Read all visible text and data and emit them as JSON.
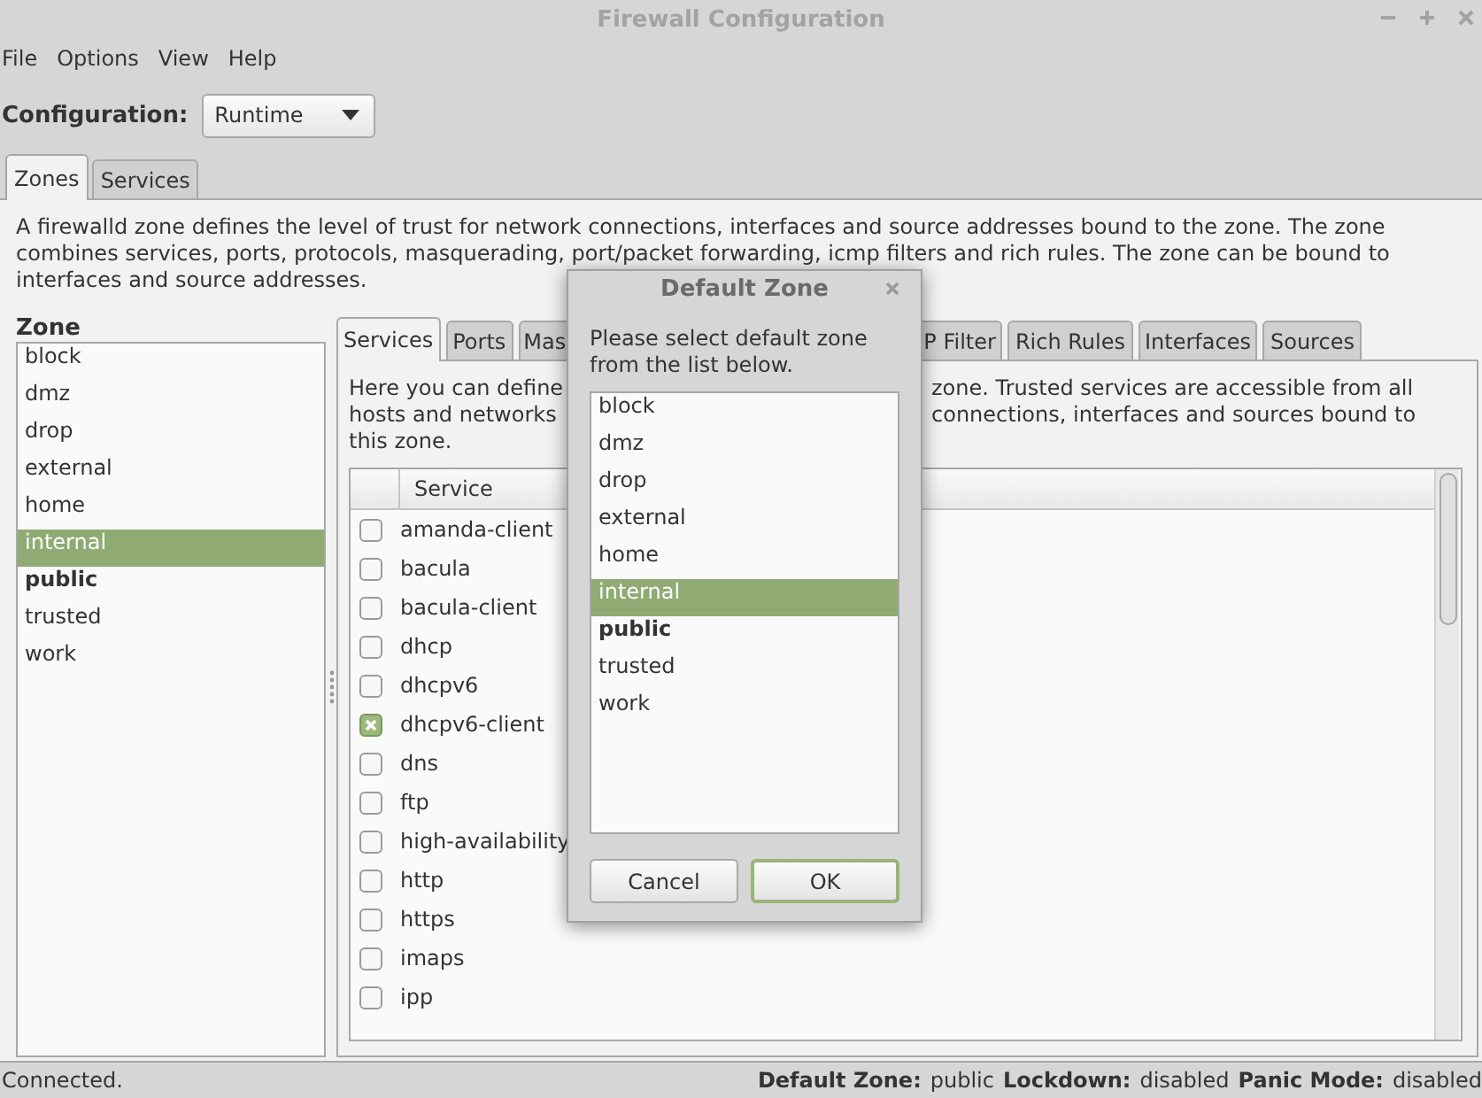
{
  "window": {
    "title": "Firewall Configuration"
  },
  "menu": [
    "File",
    "Options",
    "View",
    "Help"
  ],
  "configuration": {
    "label": "Configuration:",
    "value": "Runtime"
  },
  "tabs": [
    {
      "label": "Zones",
      "selected": true
    },
    {
      "label": "Services",
      "selected": false
    }
  ],
  "zones_description": [
    "A firewalld zone defines the level of trust for network connections, interfaces and source addresses bound to the zone. The zone",
    "combines services, ports, protocols, masquerading, port/packet forwarding, icmp filters and rich rules. The zone can be bound to",
    "interfaces and source addresses."
  ],
  "zone_list": {
    "label": "Zone",
    "items": [
      {
        "name": "block",
        "selected": false,
        "default": false
      },
      {
        "name": "dmz",
        "selected": false,
        "default": false
      },
      {
        "name": "drop",
        "selected": false,
        "default": false
      },
      {
        "name": "external",
        "selected": false,
        "default": false
      },
      {
        "name": "home",
        "selected": false,
        "default": false
      },
      {
        "name": "internal",
        "selected": true,
        "default": false
      },
      {
        "name": "public",
        "selected": false,
        "default": true
      },
      {
        "name": "trusted",
        "selected": false,
        "default": false
      },
      {
        "name": "work",
        "selected": false,
        "default": false
      }
    ]
  },
  "zone_tabs": [
    {
      "label": "Services",
      "selected": true,
      "kind": "tab"
    },
    {
      "label": "Ports",
      "selected": false,
      "kind": "tab"
    },
    {
      "label": "Mas",
      "selected": false,
      "kind": "cut-right"
    },
    {
      "label": "P Filter",
      "selected": false,
      "kind": "cut-left"
    },
    {
      "label": "Rich Rules",
      "selected": false,
      "kind": "tab"
    },
    {
      "label": "Interfaces",
      "selected": false,
      "kind": "tab"
    },
    {
      "label": "Sources",
      "selected": false,
      "kind": "tab"
    }
  ],
  "services_description": [
    {
      "left": "Here you can define",
      "right": "zone. Trusted services are accessible from all"
    },
    {
      "left": "hosts and networks",
      "right": "connections, interfaces and sources bound to"
    },
    {
      "left": "this zone."
    }
  ],
  "services_table": {
    "columns": [
      "Service"
    ],
    "rows": [
      {
        "name": "amanda-client",
        "checked": false
      },
      {
        "name": "bacula",
        "checked": false
      },
      {
        "name": "bacula-client",
        "checked": false
      },
      {
        "name": "dhcp",
        "checked": false
      },
      {
        "name": "dhcpv6",
        "checked": false
      },
      {
        "name": "dhcpv6-client",
        "checked": true
      },
      {
        "name": "dns",
        "checked": false
      },
      {
        "name": "ftp",
        "checked": false
      },
      {
        "name": "high-availability",
        "checked": false
      },
      {
        "name": "http",
        "checked": false
      },
      {
        "name": "https",
        "checked": false
      },
      {
        "name": "imaps",
        "checked": false
      },
      {
        "name": "ipp",
        "checked": false
      }
    ]
  },
  "dialog": {
    "title": "Default Zone",
    "message": "Please select default zone from the list below.",
    "items": [
      {
        "name": "block",
        "selected": false,
        "default": false
      },
      {
        "name": "dmz",
        "selected": false,
        "default": false
      },
      {
        "name": "drop",
        "selected": false,
        "default": false
      },
      {
        "name": "external",
        "selected": false,
        "default": false
      },
      {
        "name": "home",
        "selected": false,
        "default": false
      },
      {
        "name": "internal",
        "selected": true,
        "default": false
      },
      {
        "name": "public",
        "selected": false,
        "default": true
      },
      {
        "name": "trusted",
        "selected": false,
        "default": false
      },
      {
        "name": "work",
        "selected": false,
        "default": false
      }
    ],
    "buttons": [
      {
        "label": "Cancel",
        "default": false
      },
      {
        "label": "OK",
        "default": true
      }
    ]
  },
  "status_bar": {
    "text": "Connected.",
    "fields": [
      {
        "label": "Default Zone:",
        "value": "public"
      },
      {
        "label": "Lockdown:",
        "value": "disabled"
      },
      {
        "label": "Panic Mode:",
        "value": "disabled"
      }
    ]
  }
}
